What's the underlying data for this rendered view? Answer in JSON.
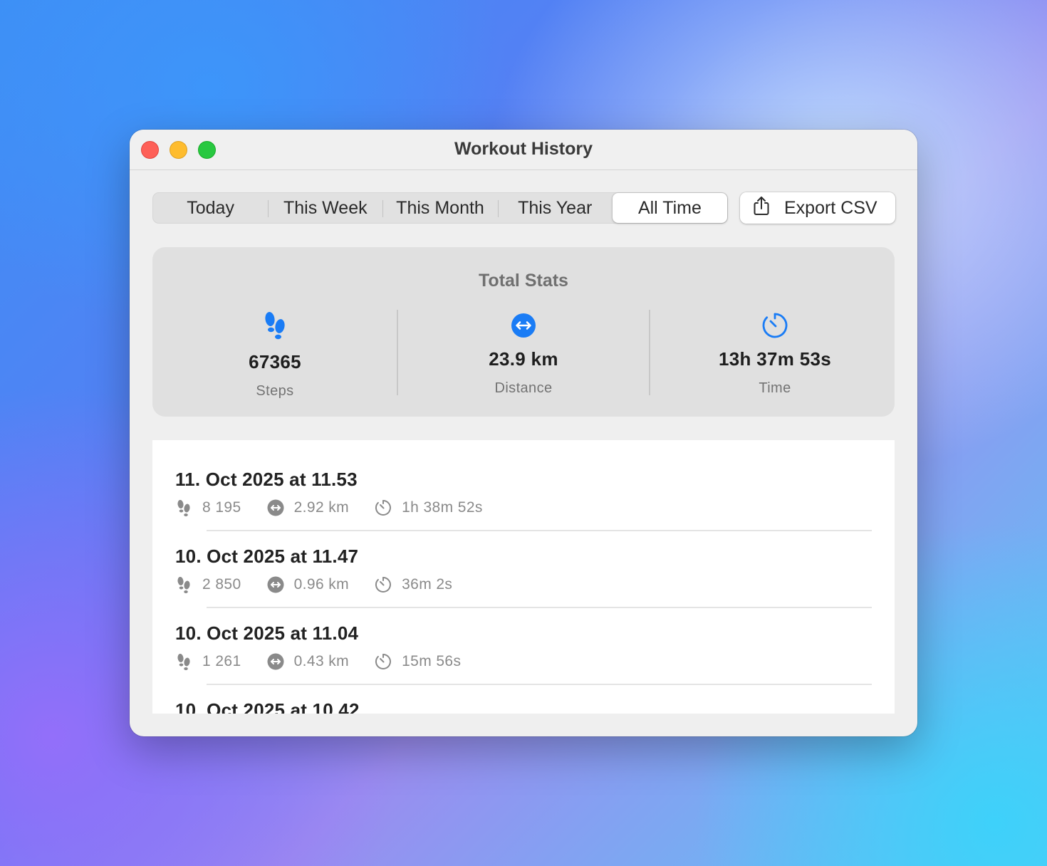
{
  "window": {
    "title": "Workout History"
  },
  "filters": {
    "tabs": [
      {
        "label": "Today"
      },
      {
        "label": "This Week"
      },
      {
        "label": "This Month"
      },
      {
        "label": "This Year"
      },
      {
        "label": "All Time"
      }
    ],
    "selected": "All Time"
  },
  "toolbar": {
    "export_label": "Export CSV"
  },
  "stats": {
    "title": "Total Stats",
    "steps": {
      "value": "67365",
      "label": "Steps",
      "icon": "footprints-icon"
    },
    "distance": {
      "value": "23.9 km",
      "label": "Distance",
      "icon": "arrows-left-right-icon"
    },
    "time": {
      "value": "13h 37m 53s",
      "label": "Time",
      "icon": "timer-icon"
    }
  },
  "colors": {
    "accent": "#1a7cf5",
    "meta": "#8a8a8a"
  },
  "workouts": [
    {
      "date": "11. Oct 2025 at 11.53",
      "steps": "8 195",
      "distance": "2.92 km",
      "duration": "1h 38m 52s"
    },
    {
      "date": "10. Oct 2025 at 11.47",
      "steps": "2 850",
      "distance": "0.96 km",
      "duration": "36m 2s"
    },
    {
      "date": "10. Oct 2025 at 11.04",
      "steps": "1 261",
      "distance": "0.43 km",
      "duration": "15m 56s"
    },
    {
      "date": "10. Oct 2025 at 10.42"
    }
  ]
}
